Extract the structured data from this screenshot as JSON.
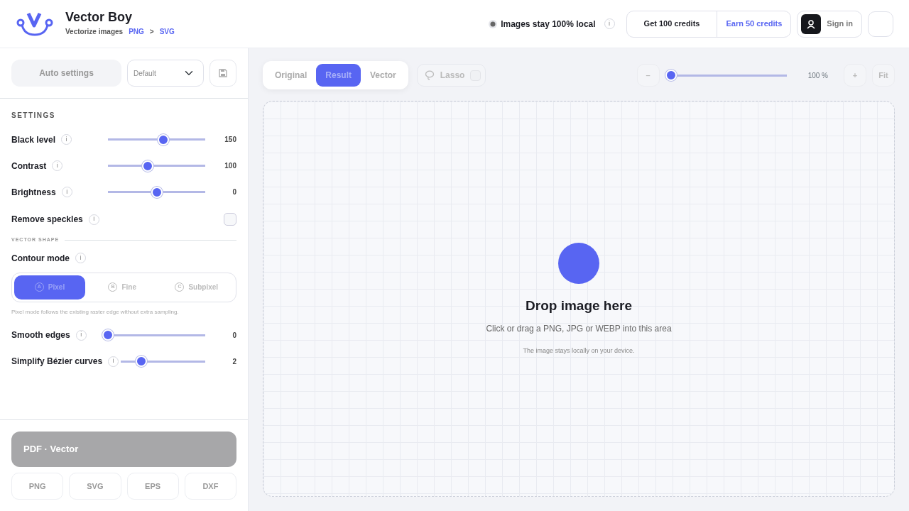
{
  "header": {
    "title": "Vector Boy",
    "subtitle": "Vectorize images",
    "format_from": "PNG",
    "arrow": ">",
    "format_to": "SVG"
  },
  "privacy": {
    "label": "Images stay 100% local",
    "info": "i"
  },
  "credits": [
    {
      "label": "Get 100 credits",
      "kind": "primary"
    },
    {
      "label": "Earn 50 credits",
      "kind": "link"
    }
  ],
  "sign_in": {
    "label": "Sign in"
  },
  "presets": {
    "auto_label": "Auto settings",
    "select": "Default"
  },
  "settings_heading": "SETTINGS",
  "settings": [
    {
      "kind": "slider",
      "label": "Black level",
      "info": "i",
      "level": 0.57,
      "reading": "150"
    },
    {
      "kind": "slider",
      "label": "Contrast",
      "info": "i",
      "level": 0.41,
      "reading": "100"
    },
    {
      "kind": "slider",
      "label": "Brightness",
      "info": "i",
      "level": 0.5,
      "reading": "0"
    },
    {
      "kind": "checkbox",
      "label": "Remove speckles",
      "info": "i",
      "checked": false
    }
  ],
  "section_heading": "VECTOR SHAPE",
  "contour": {
    "label": "Contour mode",
    "info": "i",
    "options": [
      {
        "letter": "A",
        "label": "Pixel",
        "selected": true
      },
      {
        "letter": "B",
        "label": "Fine",
        "selected": false
      },
      {
        "letter": "C",
        "label": "Subpixel",
        "selected": false
      }
    ],
    "hint": "Pixel mode follows the existing raster edge without extra sampling."
  },
  "shape_settings": [
    {
      "kind": "slider",
      "label": "Smooth edges",
      "info": "i",
      "level": 0,
      "reading": "0"
    },
    {
      "kind": "slider",
      "label": "Simplify Bézier curves",
      "info": "i",
      "level": 0.24,
      "reading": "2"
    }
  ],
  "export": {
    "primary": "PDF · Vector",
    "formats": [
      "PNG",
      "SVG",
      "EPS",
      "DXF"
    ]
  },
  "view_tabs": [
    {
      "label": "Original",
      "selected": false
    },
    {
      "label": "Result",
      "selected": true
    },
    {
      "label": "Vector",
      "selected": false
    }
  ],
  "lasso": {
    "label": "Lasso",
    "checked": false
  },
  "zoom": {
    "minus": "–",
    "level": 0,
    "reading": "100 %",
    "plus": "+",
    "fit": "Fit"
  },
  "dropzone": {
    "title": "Drop image here",
    "subtitle": "Click or drag a PNG, JPG or WEBP into this area",
    "note": "The image stays locally on your device."
  }
}
